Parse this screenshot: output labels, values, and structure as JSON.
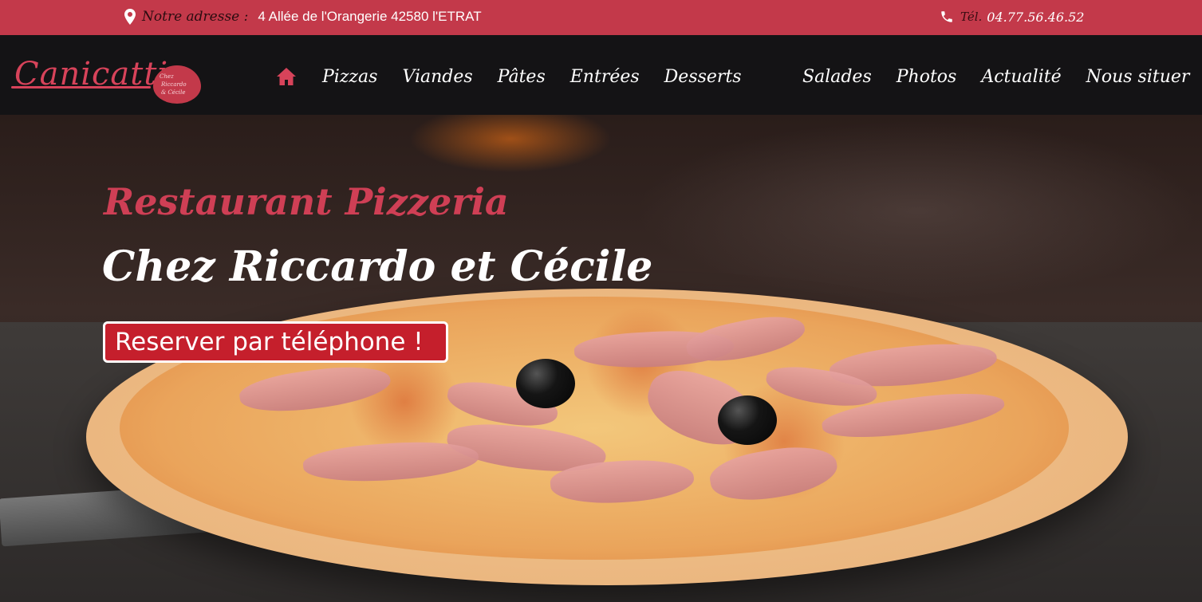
{
  "topbar": {
    "address_label": "Notre adresse :",
    "address_value": "4 Allée de l'Orangerie 42580 l'ETRAT",
    "tel_label": "Tél.",
    "tel_value": "04.77.56.46.52"
  },
  "logo": {
    "name": "Canicatti",
    "tagline_1": "Chez",
    "tagline_2": "Riccardo",
    "tagline_3": "& Cécile"
  },
  "nav": {
    "items": [
      {
        "label": "Pizzas"
      },
      {
        "label": "Viandes"
      },
      {
        "label": "Pâtes"
      },
      {
        "label": "Entrées"
      },
      {
        "label": "Desserts"
      },
      {
        "label": "Salades"
      },
      {
        "label": "Photos"
      },
      {
        "label": "Actualité"
      },
      {
        "label": "Nous situer"
      }
    ]
  },
  "hero": {
    "title": "Restaurant Pizzeria",
    "subtitle": "Chez Riccardo et Cécile",
    "cta_label": "Reserver par téléphone !"
  },
  "colors": {
    "brand_red": "#c3394a",
    "cta_red": "#c51f2c",
    "nav_bg": "#1e1e20"
  },
  "icons": {
    "address": "map-pin-icon",
    "phone": "phone-icon",
    "home": "home-icon"
  }
}
